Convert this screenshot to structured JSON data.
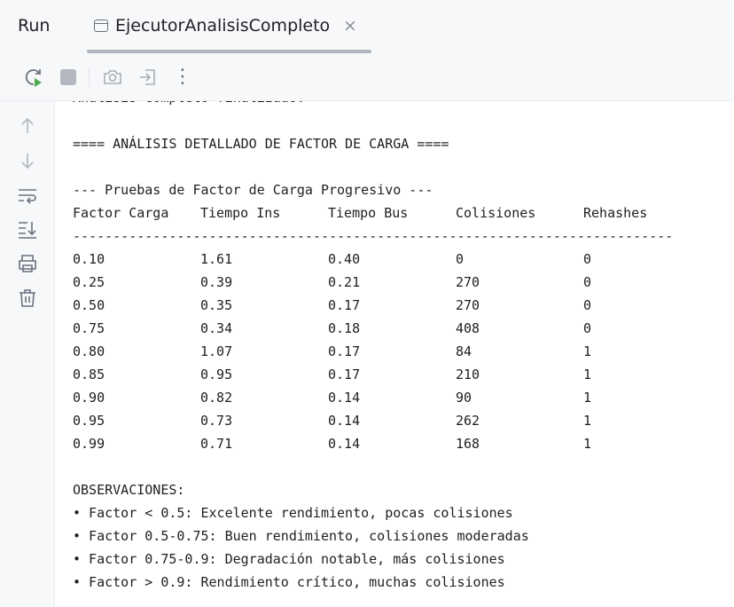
{
  "header": {
    "run_label": "Run",
    "tab": {
      "title": "EjecutorAnalisisCompleto",
      "close": "×"
    }
  },
  "toolbar": {
    "buttons": [
      "rerun-icon",
      "stop-icon",
      "camera-icon",
      "import-icon",
      "more-icon"
    ],
    "more_glyph": "⋮"
  },
  "gutter": {
    "buttons": [
      "arrow-up-icon",
      "arrow-down-icon",
      "soft-wrap-icon",
      "scroll-to-end-icon",
      "print-icon",
      "trash-icon"
    ]
  },
  "console": {
    "clipped_line": "Análisis completo finalizado.",
    "section_title": "==== ANÁLISIS DETALLADO DE FACTOR DE CARGA ====",
    "subtitle": "--- Pruebas de Factor de Carga Progresivo ---",
    "table": {
      "headers": [
        "Factor Carga",
        "Tiempo Ins",
        "Tiempo Bus",
        "Colisiones",
        "Rehashes"
      ],
      "separator": "---------------------------------------------------------------------------",
      "rows": [
        [
          "0.10",
          "1.61",
          "0.40",
          "0",
          "0"
        ],
        [
          "0.25",
          "0.39",
          "0.21",
          "270",
          "0"
        ],
        [
          "0.50",
          "0.35",
          "0.17",
          "270",
          "0"
        ],
        [
          "0.75",
          "0.34",
          "0.18",
          "408",
          "0"
        ],
        [
          "0.80",
          "1.07",
          "0.17",
          "84",
          "1"
        ],
        [
          "0.85",
          "0.95",
          "0.17",
          "210",
          "1"
        ],
        [
          "0.90",
          "0.82",
          "0.14",
          "90",
          "1"
        ],
        [
          "0.95",
          "0.73",
          "0.14",
          "262",
          "1"
        ],
        [
          "0.99",
          "0.71",
          "0.14",
          "168",
          "1"
        ]
      ]
    },
    "observations_title": "OBSERVACIONES:",
    "observations": [
      "• Factor < 0.5: Excelente rendimiento, pocas colisiones",
      "• Factor 0.5-0.75: Buen rendimiento, colisiones moderadas",
      "• Factor 0.75-0.9: Degradación notable, más colisiones",
      "• Factor > 0.9: Rendimiento crítico, muchas colisiones"
    ]
  }
}
